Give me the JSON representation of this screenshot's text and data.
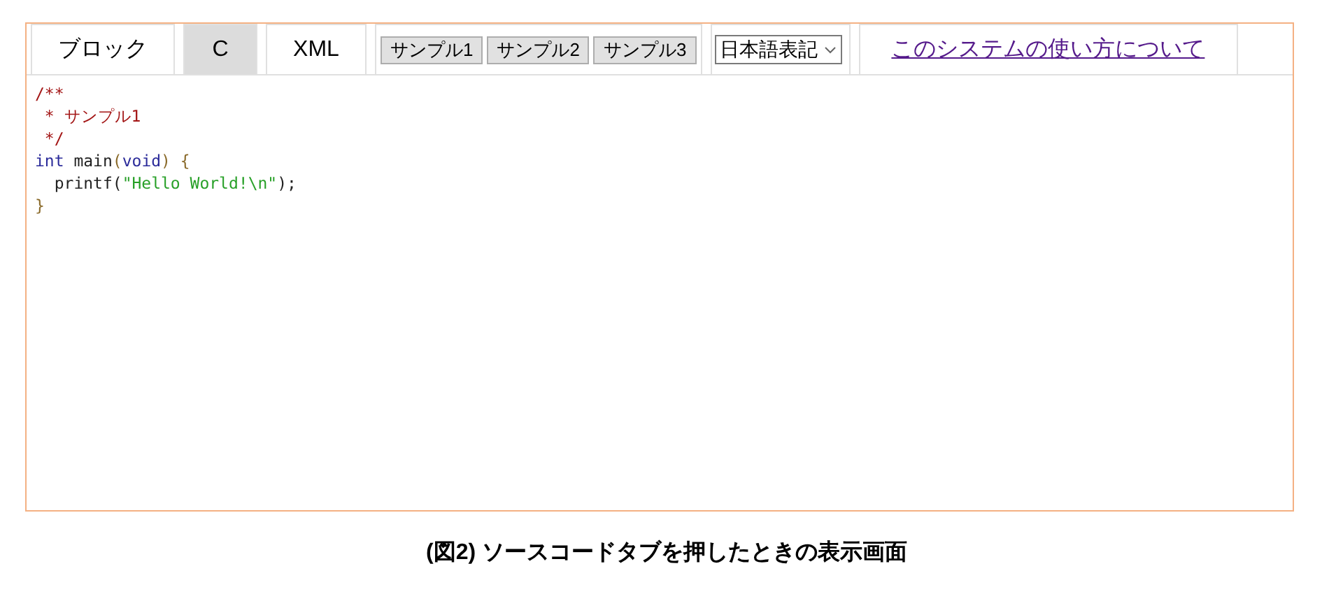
{
  "tabs": [
    {
      "label": "ブロック",
      "selected": false
    },
    {
      "label": "C",
      "selected": true
    },
    {
      "label": "XML",
      "selected": false
    }
  ],
  "sample_buttons": [
    "サンプル1",
    "サンプル2",
    "サンプル3"
  ],
  "language_select": {
    "value": "日本語表記"
  },
  "help_link": "このシステムの使い方について",
  "code_lines": [
    [
      {
        "kind": "comment",
        "text": "/**"
      }
    ],
    [
      {
        "kind": "comment",
        "text": " * サンプル1"
      }
    ],
    [
      {
        "kind": "comment",
        "text": " */"
      }
    ],
    [
      {
        "kind": "keyword",
        "text": "int"
      },
      {
        "kind": "plain",
        "text": " main"
      },
      {
        "kind": "punct",
        "text": "("
      },
      {
        "kind": "keyword",
        "text": "void"
      },
      {
        "kind": "punct",
        "text": ") {"
      }
    ],
    [
      {
        "kind": "plain",
        "text": "  printf("
      },
      {
        "kind": "string",
        "text": "\"Hello World!\\n\""
      },
      {
        "kind": "plain",
        "text": ");"
      }
    ],
    [
      {
        "kind": "punct",
        "text": "}"
      }
    ]
  ],
  "caption": "(図2)  ソースコードタブを押したときの表示画面"
}
